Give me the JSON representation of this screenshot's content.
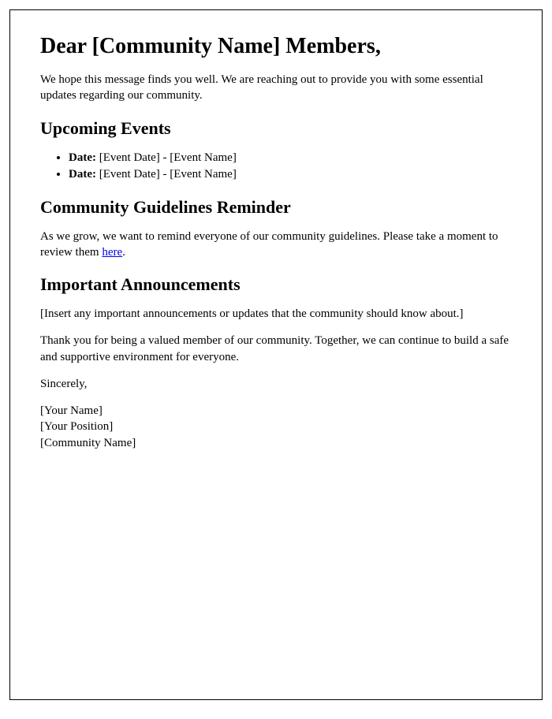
{
  "greeting": "Dear [Community Name] Members,",
  "intro": "We hope this message finds you well. We are reaching out to provide you with some essential updates regarding our community.",
  "sections": {
    "events": {
      "heading": "Upcoming Events",
      "items": [
        {
          "label": "Date:",
          "text": " [Event Date] - [Event Name]"
        },
        {
          "label": "Date:",
          "text": " [Event Date] - [Event Name]"
        }
      ]
    },
    "guidelines": {
      "heading": "Community Guidelines Reminder",
      "text_before": "As we grow, we want to remind everyone of our community guidelines. Please take a moment to review them ",
      "link_text": "here",
      "text_after": "."
    },
    "announcements": {
      "heading": "Important Announcements",
      "placeholder": "[Insert any important announcements or updates that the community should know about.]"
    }
  },
  "thanks": "Thank you for being a valued member of our community. Together, we can continue to build a safe and supportive environment for everyone.",
  "closing": "Sincerely,",
  "signature": {
    "name": "[Your Name]",
    "position": "[Your Position]",
    "community": "[Community Name]"
  }
}
